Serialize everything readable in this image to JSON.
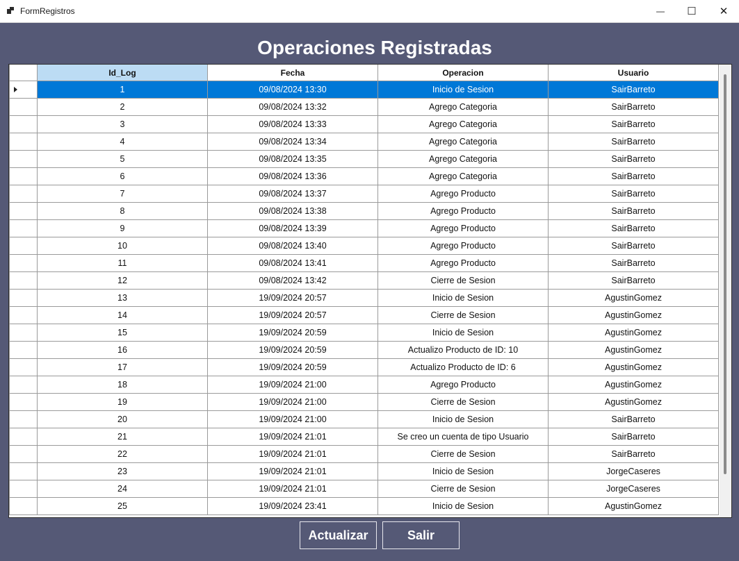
{
  "window": {
    "title": "FormRegistros"
  },
  "window_controls": {
    "minimize": "—",
    "maximize": "☐",
    "close": "✕"
  },
  "heading": "Operaciones Registradas",
  "columns": [
    "Id_Log",
    "Fecha",
    "Operacion",
    "Usuario"
  ],
  "sorted_column_index": 0,
  "selected_row_index": 0,
  "rows": [
    [
      "1",
      "09/08/2024 13:30",
      "Inicio de Sesion",
      "SairBarreto"
    ],
    [
      "2",
      "09/08/2024 13:32",
      "Agrego Categoria",
      "SairBarreto"
    ],
    [
      "3",
      "09/08/2024 13:33",
      "Agrego Categoria",
      "SairBarreto"
    ],
    [
      "4",
      "09/08/2024 13:34",
      "Agrego Categoria",
      "SairBarreto"
    ],
    [
      "5",
      "09/08/2024 13:35",
      "Agrego Categoria",
      "SairBarreto"
    ],
    [
      "6",
      "09/08/2024 13:36",
      "Agrego Categoria",
      "SairBarreto"
    ],
    [
      "7",
      "09/08/2024 13:37",
      "Agrego Producto",
      "SairBarreto"
    ],
    [
      "8",
      "09/08/2024 13:38",
      "Agrego Producto",
      "SairBarreto"
    ],
    [
      "9",
      "09/08/2024 13:39",
      "Agrego Producto",
      "SairBarreto"
    ],
    [
      "10",
      "09/08/2024 13:40",
      "Agrego Producto",
      "SairBarreto"
    ],
    [
      "11",
      "09/08/2024 13:41",
      "Agrego Producto",
      "SairBarreto"
    ],
    [
      "12",
      "09/08/2024 13:42",
      "Cierre de Sesion",
      "SairBarreto"
    ],
    [
      "13",
      "19/09/2024 20:57",
      "Inicio de Sesion",
      "AgustinGomez"
    ],
    [
      "14",
      "19/09/2024 20:57",
      "Cierre de Sesion",
      "AgustinGomez"
    ],
    [
      "15",
      "19/09/2024 20:59",
      "Inicio de Sesion",
      "AgustinGomez"
    ],
    [
      "16",
      "19/09/2024 20:59",
      "Actualizo Producto de ID: 10",
      "AgustinGomez"
    ],
    [
      "17",
      "19/09/2024 20:59",
      "Actualizo Producto de ID: 6",
      "AgustinGomez"
    ],
    [
      "18",
      "19/09/2024 21:00",
      "Agrego Producto",
      "AgustinGomez"
    ],
    [
      "19",
      "19/09/2024 21:00",
      "Cierre de Sesion",
      "AgustinGomez"
    ],
    [
      "20",
      "19/09/2024 21:00",
      "Inicio de Sesion",
      "SairBarreto"
    ],
    [
      "21",
      "19/09/2024 21:01",
      "Se creo un cuenta de tipo Usuario",
      "SairBarreto"
    ],
    [
      "22",
      "19/09/2024 21:01",
      "Cierre de Sesion",
      "SairBarreto"
    ],
    [
      "23",
      "19/09/2024 21:01",
      "Inicio de Sesion",
      "JorgeCaseres"
    ],
    [
      "24",
      "19/09/2024 21:01",
      "Cierre de Sesion",
      "JorgeCaseres"
    ],
    [
      "25",
      "19/09/2024 23:41",
      "Inicio de Sesion",
      "AgustinGomez"
    ]
  ],
  "buttons": {
    "refresh": "Actualizar",
    "exit": "Salir"
  },
  "colors": {
    "background": "#555976",
    "selection": "#0078d7",
    "sorted_header": "#bcdcf4"
  }
}
